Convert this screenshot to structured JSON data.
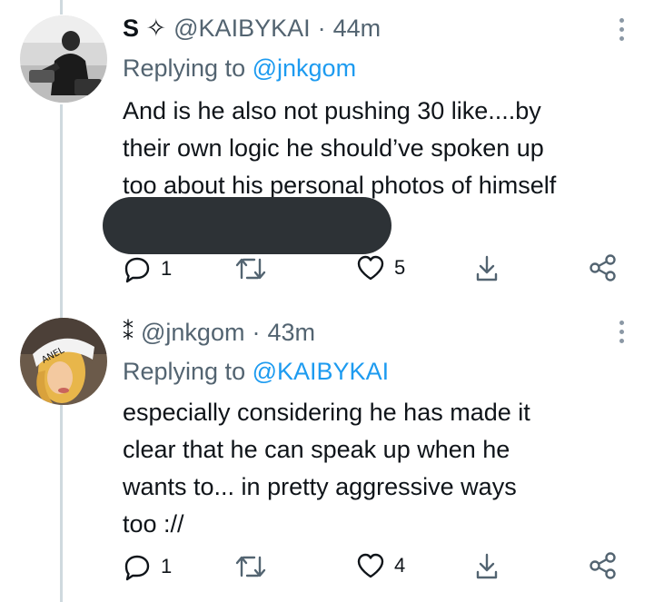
{
  "tweets": [
    {
      "display_name": "S ✧",
      "handle": "@KAIBYKAI",
      "time": "44m",
      "replying_label": "Replying to",
      "replying_to": "@jnkgom",
      "text": "And is he also not pushing 30 like....by\ntheir own logic he should’ve spoken up\ntoo about his personal photos of himself",
      "reply_count": "1",
      "retweet_count": "",
      "like_count": "5"
    },
    {
      "display_name": "⁑",
      "handle": "@jnkgom",
      "time": "43m",
      "replying_label": "Replying to",
      "replying_to": "@KAIBYKAI",
      "text": "especially considering he has made it\nclear that he can speak up when he\nwants to... in pretty aggressive ways\ntoo ://",
      "reply_count": "1",
      "retweet_count": "",
      "like_count": "4",
      "avatar_headband_text": "ANEL"
    }
  ],
  "colors": {
    "text": "#0f1419",
    "muted": "#536471",
    "link": "#1d9bf0",
    "thread_line": "#cfd9de"
  },
  "icons": [
    "reply-icon",
    "retweet-icon",
    "like-icon",
    "bookmark-icon",
    "share-icon",
    "more-icon"
  ]
}
